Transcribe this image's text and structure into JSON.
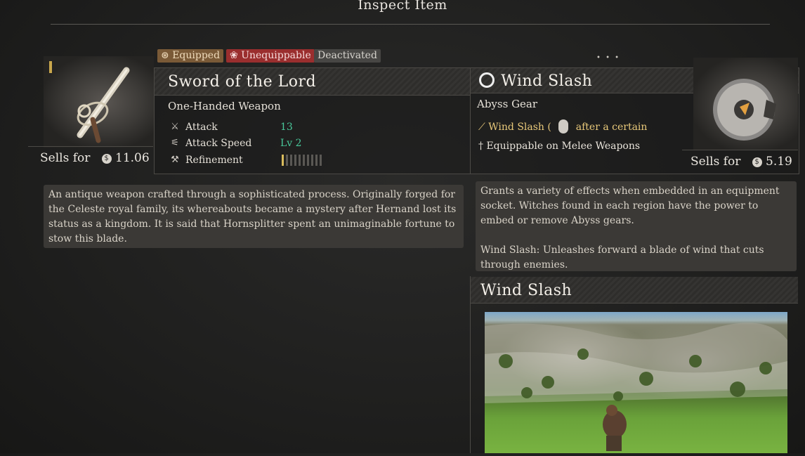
{
  "screen_title": "Inspect Item",
  "tags": {
    "equipped": "Equipped",
    "unequippable": "Unequippable",
    "deactivated": "Deactivated"
  },
  "weapon": {
    "name": "Sword of the Lord",
    "type": "One-Handed Weapon",
    "stats": [
      {
        "label": "Attack",
        "value": "13",
        "icon": "sword-icon"
      },
      {
        "label": "Attack Speed",
        "value": "Lv 2",
        "icon": "speed-icon"
      },
      {
        "label": "Refinement",
        "value": "",
        "icon": "anvil-icon"
      }
    ],
    "refinement_level": 1,
    "refinement_max": 10,
    "sells_label": "Sells for",
    "sells_value": "11.06",
    "description": "An antique weapon crafted through a sophisticated process. Originally forged for the Celeste royal family, its whereabouts became a mystery after Hernand lost its status as a kingdom. It is said that Hornsplitter spent an unimaginable fortune to stow this blade."
  },
  "gear": {
    "name": "Wind Slash",
    "type": "Abyss Gear",
    "skill_line_a": "Wind Slash (",
    "skill_line_b": "after a certain",
    "equip_line": "Equippable on Melee Weapons",
    "sells_label": "Sells for",
    "sells_value": "5.19",
    "description_1": "Grants a variety of effects when embedded in an equipment socket. Witches found in each region have the power to embed or remove Abyss gears.",
    "description_2": "Wind Slash: Unleashes forward a blade of wind that cuts through enemies.",
    "preview_title": "Wind Slash"
  },
  "colors": {
    "stat_value": "#49c89a",
    "accent_gold": "#e9c97a",
    "unequippable_red": "#9a2e2e",
    "equipped_brown": "#7a5a37"
  }
}
